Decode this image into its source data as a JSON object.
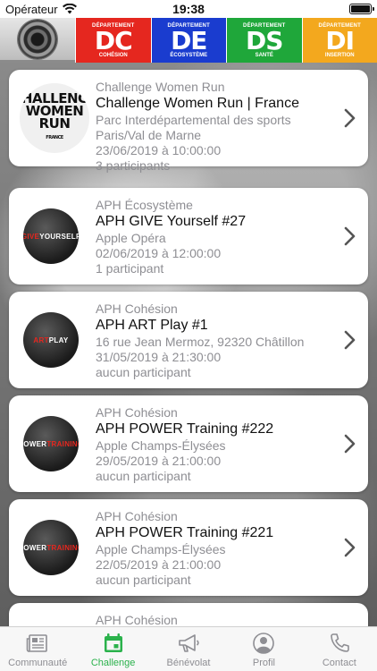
{
  "status_bar": {
    "carrier": "Opérateur",
    "time": "19:38"
  },
  "header": {
    "departments": [
      {
        "top": "DÉPARTEMENT",
        "code": "DC",
        "sub": "COHÉSION",
        "color": "#e5271f"
      },
      {
        "top": "DÉPARTEMENT",
        "code": "DE",
        "sub": "ÉCOSYSTÈME",
        "color": "#1a3ccf"
      },
      {
        "top": "DÉPARTEMENT",
        "code": "DS",
        "sub": "SANTÉ",
        "color": "#1fa73a"
      },
      {
        "top": "DÉPARTEMENT",
        "code": "DI",
        "sub": "INSERTION",
        "color": "#f3a81e"
      }
    ]
  },
  "events": [
    {
      "organizer": "Challenge Women Run",
      "title": "Challenge Women Run | France",
      "lines": [
        "Parc Interdépartemental des sports",
        "Paris/Val de Marne",
        "23/06/2019 à 10:00:00",
        "3 participants"
      ],
      "thumb": {
        "line1": "CHALLENGE",
        "line2": "WOMEN RUN",
        "line3": "FRANCE"
      }
    },
    {
      "organizer": "APH Écosystème",
      "title": "APH GIVE Yourself #27",
      "lines": [
        "Apple Opéra",
        "02/06/2019 à 12:00:00",
        "1 participant"
      ],
      "thumb": {
        "accent": "GIVE",
        "rest": "YOURSELF"
      }
    },
    {
      "organizer": "APH Cohésion",
      "title": "APH ART Play #1",
      "lines": [
        "16 rue Jean Mermoz, 92320 Châtillon",
        "31/05/2019 à 21:30:00",
        "aucun participant"
      ],
      "thumb": {
        "accent": "ART",
        "rest": "PLAY"
      }
    },
    {
      "organizer": "APH Cohésion",
      "title": "APH POWER Training #222",
      "lines": [
        "Apple Champs-Élysées",
        "29/05/2019 à 21:00:00",
        "aucun participant"
      ],
      "thumb": {
        "accent": "POWER",
        "rest": "TRAINING"
      }
    },
    {
      "organizer": "APH Cohésion",
      "title": "APH POWER Training #221",
      "lines": [
        "Apple Champs-Élysées",
        "22/05/2019 à 21:00:00",
        "aucun participant"
      ],
      "thumb": {
        "accent": "POWER",
        "rest": "TRAINING"
      }
    },
    {
      "organizer": "APH Cohésion",
      "title": "",
      "lines": [],
      "thumb": {}
    }
  ],
  "tabbar": {
    "items": [
      {
        "label": "Communauté",
        "icon": "newspaper-icon",
        "active": false
      },
      {
        "label": "Challenge",
        "icon": "calendar-icon",
        "active": true
      },
      {
        "label": "Bénévolat",
        "icon": "megaphone-icon",
        "active": false
      },
      {
        "label": "Profil",
        "icon": "person-icon",
        "active": false
      },
      {
        "label": "Contact",
        "icon": "phone-icon",
        "active": false
      }
    ],
    "active_color": "#2bb24c",
    "inactive_color": "#8e8e93"
  }
}
